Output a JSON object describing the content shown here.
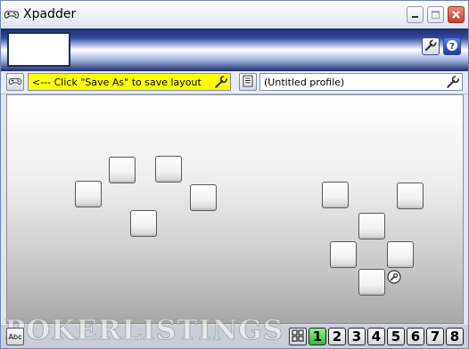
{
  "window": {
    "title": "Xpadder"
  },
  "layout_field": {
    "value": "<--- Click \"Save As\" to save layout"
  },
  "profile_field": {
    "value": "(Untitled profile)"
  },
  "statusbar": {
    "watermark": "POKERLISTINGS",
    "abc_label": "Abc",
    "set_buttons": [
      "1",
      "2",
      "3",
      "4",
      "5",
      "6",
      "7",
      "8"
    ],
    "active_set": "1"
  },
  "colors": {
    "layout_field_bg": "#ffff00",
    "active_set_bg": "#3ccf3c",
    "toolband": "#2b3d8a"
  },
  "icons": {
    "title": "gamepad-icon",
    "minimize": "minimize-icon",
    "maximize": "maximize-icon",
    "close": "close-icon",
    "settings": "wrench-icon",
    "help": "help-icon"
  }
}
